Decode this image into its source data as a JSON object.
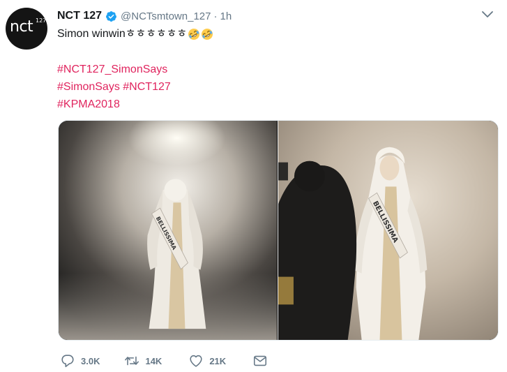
{
  "account": {
    "display_name": "NCT 127",
    "handle": "@NCTsmtown_127",
    "separator": "·",
    "time": "1h",
    "avatar_logo": "nct",
    "avatar_logo_sup": "127"
  },
  "tweet": {
    "text": "Simon winwinㅎㅎㅎㅎㅎㅎ",
    "emojis": [
      "rolling-on-floor-laughing-emoji",
      "rolling-on-floor-laughing-emoji"
    ],
    "hashtag_lines": [
      [
        "#NCT127_SimonSays"
      ],
      [
        "#SimonSays",
        "#NCT127"
      ],
      [
        "#KPMA2018"
      ]
    ]
  },
  "media": {
    "photos": [
      {
        "alt": "photo-left"
      },
      {
        "alt": "photo-right"
      }
    ],
    "sash_text": "BELLISSIMA"
  },
  "actions": {
    "reply_count": "3.0K",
    "retweet_count": "14K",
    "like_count": "21K"
  },
  "colors": {
    "hashtag": "#e0245e",
    "muted": "#657786",
    "verified": "#1da1f2",
    "text": "#14171a"
  },
  "icons": [
    "verified-badge-icon",
    "caret-down-icon",
    "reply-icon",
    "retweet-icon",
    "like-icon",
    "direct-message-icon"
  ]
}
